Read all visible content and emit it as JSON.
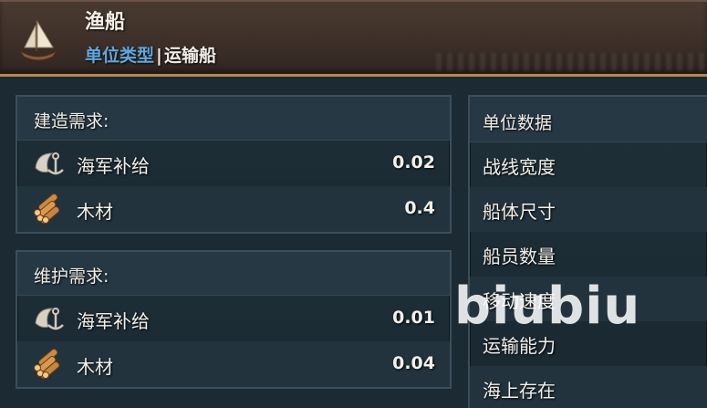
{
  "header": {
    "title": "渔船",
    "unit_type_key": "单位类型",
    "separator": "|",
    "unit_type_value": "运输船",
    "icon": "sailboat-icon"
  },
  "build": {
    "title": "建造需求:",
    "items": [
      {
        "icon": "naval-supply-icon",
        "label": "海军补给",
        "value": "0.02"
      },
      {
        "icon": "timber-icon",
        "label": "木材",
        "value": "0.4"
      }
    ]
  },
  "upkeep": {
    "title": "维护需求:",
    "items": [
      {
        "icon": "naval-supply-icon",
        "label": "海军补给",
        "value": "0.01"
      },
      {
        "icon": "timber-icon",
        "label": "木材",
        "value": "0.04"
      }
    ]
  },
  "stats": {
    "title": "单位数据",
    "items": [
      "战线宽度",
      "船体尺寸",
      "船员数量",
      "移动速度",
      "运输能力",
      "海上存在"
    ]
  },
  "watermark": "biubiu",
  "colors": {
    "accent_blue": "#5fa8de",
    "header_brown": "#3e3029",
    "border_gold": "#b8874f",
    "panel_bg": "#1f3039"
  }
}
